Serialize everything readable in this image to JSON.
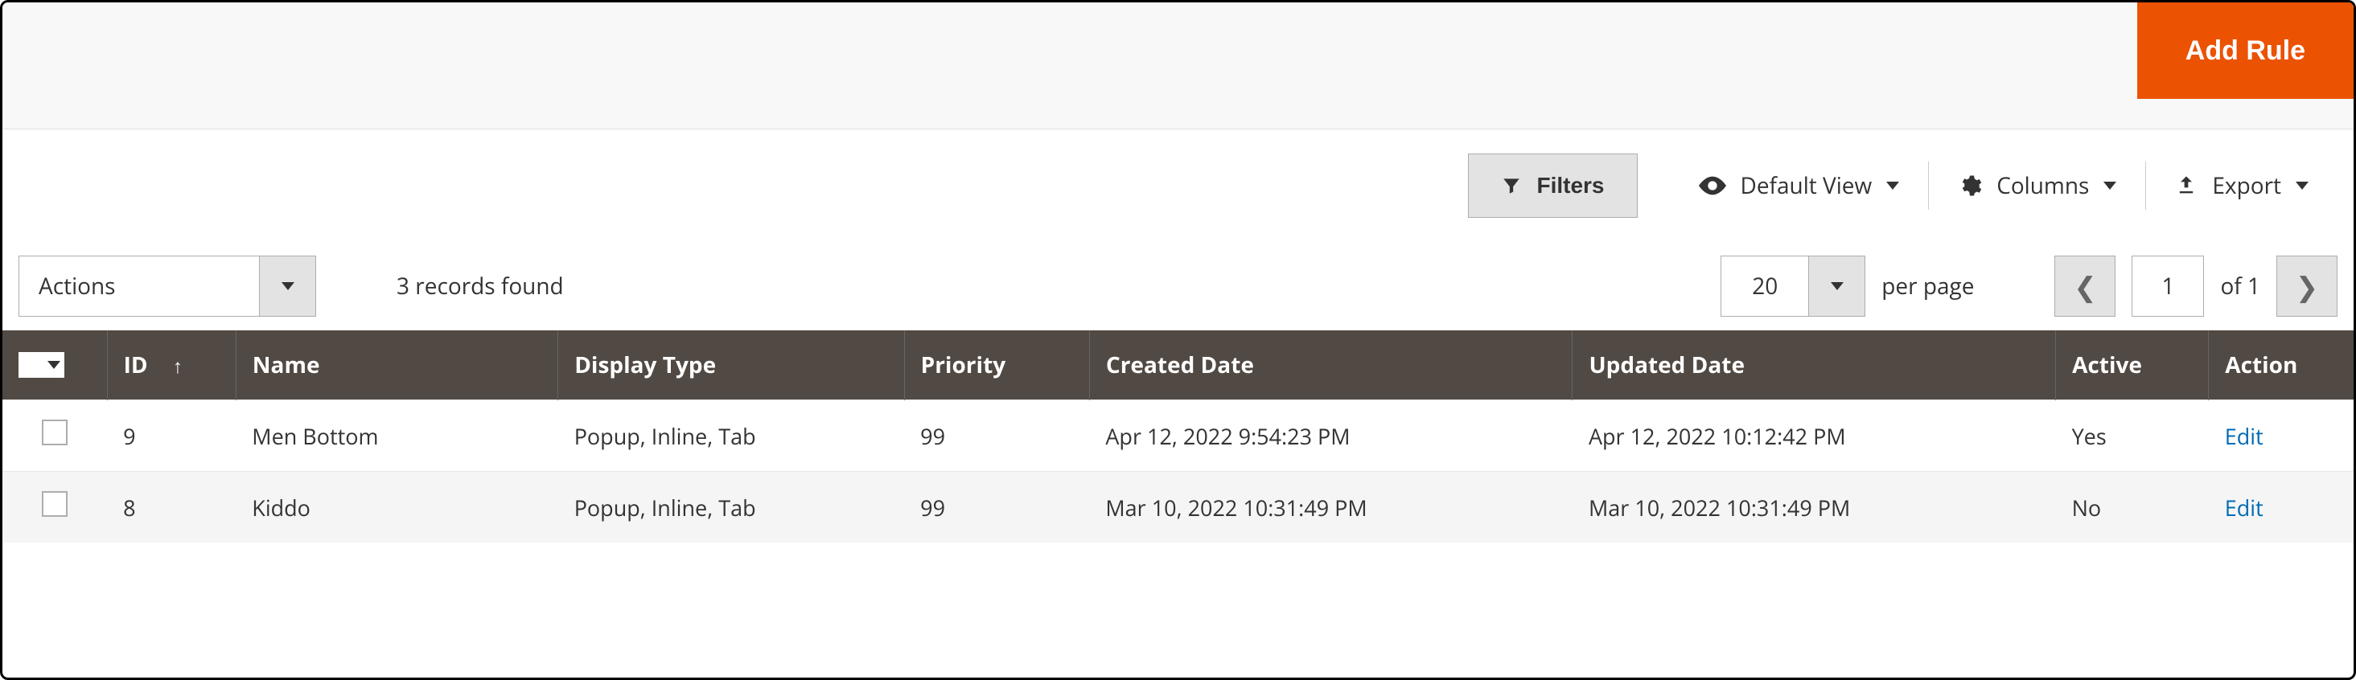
{
  "header": {
    "add_rule_label": "Add Rule"
  },
  "toolbar": {
    "filters_label": "Filters",
    "view_label": "Default View",
    "columns_label": "Columns",
    "export_label": "Export"
  },
  "controls": {
    "actions_label": "Actions",
    "records_found": "3 records found",
    "page_size": "20",
    "per_page_label": "per page",
    "current_page": "1",
    "of_label": "of 1"
  },
  "table": {
    "headers": {
      "id": "ID",
      "name": "Name",
      "display_type": "Display Type",
      "priority": "Priority",
      "created": "Created Date",
      "updated": "Updated Date",
      "active": "Active",
      "action": "Action"
    },
    "rows": [
      {
        "id": "9",
        "name": "Men Bottom",
        "display_type": "Popup, Inline, Tab",
        "priority": "99",
        "created": "Apr 12, 2022 9:54:23 PM",
        "updated": "Apr 12, 2022 10:12:42 PM",
        "active": "Yes",
        "action": "Edit"
      },
      {
        "id": "8",
        "name": "Kiddo",
        "display_type": "Popup, Inline, Tab",
        "priority": "99",
        "created": "Mar 10, 2022 10:31:49 PM",
        "updated": "Mar 10, 2022 10:31:49 PM",
        "active": "No",
        "action": "Edit"
      }
    ]
  }
}
